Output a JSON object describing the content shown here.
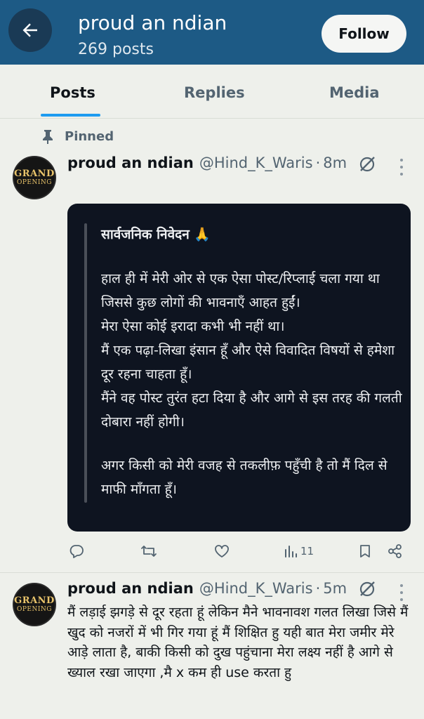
{
  "header": {
    "title": "proud an ndian",
    "post_count": "269 posts",
    "follow_label": "Follow",
    "colors": {
      "bar": "#1d5a85"
    }
  },
  "tabs": [
    {
      "label": "Posts",
      "active": true
    },
    {
      "label": "Replies",
      "active": false
    },
    {
      "label": "Media",
      "active": false
    }
  ],
  "pinned_label": "Pinned",
  "posts": [
    {
      "avatar": {
        "line1": "GRAND",
        "line2": "OPENING"
      },
      "name": "proud an ndian",
      "handle": "@Hind_K_Waris",
      "time": "8m",
      "card": {
        "title": "सार्वजनिक निवेदन 🙏",
        "lines": [
          "हाल ही में मेरी ओर से एक ऐसा पोस्ट/रिप्लाई चला गया था जिससे कुछ लोगों की भावनाएँ आहत हुईं।",
          "मेरा ऐसा कोई इरादा कभी भी नहीं था।",
          "मैं एक पढ़ा-लिखा इंसान हूँ और ऐसे विवादित विषयों से हमेशा दूर रहना चाहता हूँ।",
          "मैंने वह पोस्ट तुरंत हटा दिया है और आगे से इस तरह की गलती दोबारा नहीं होगी।",
          "अगर किसी को मेरी वजह से तकलीफ़ पहुँची है तो मैं दिल से माफी माँगता हूँ।"
        ]
      },
      "views": "11"
    },
    {
      "avatar": {
        "line1": "GRAND",
        "line2": "OPENING"
      },
      "name": "proud an ndian",
      "handle": "@Hind_K_Waris",
      "time": "5m",
      "text": "मैं लड़ाई झगड़े से दूर रहता हूं लेकिन मैने भावनावश गलत लिखा जिसे मैं खुद को नजरों में भी गिर गया हूं मैं शिक्षित हु यही बात मेरा जमीर मेरे आड़े लाता है, बाकी किसी को दुख पहुंचाना मेरा लक्ष्य नहीं है आगे से ख्याल रखा जाएगा ,मै x कम ही use करता हु"
    }
  ],
  "icons": [
    "back-arrow-icon",
    "pin-icon",
    "grok-icon",
    "more-icon",
    "reply-icon",
    "repost-icon",
    "like-icon",
    "views-icon",
    "bookmark-icon",
    "share-icon"
  ]
}
